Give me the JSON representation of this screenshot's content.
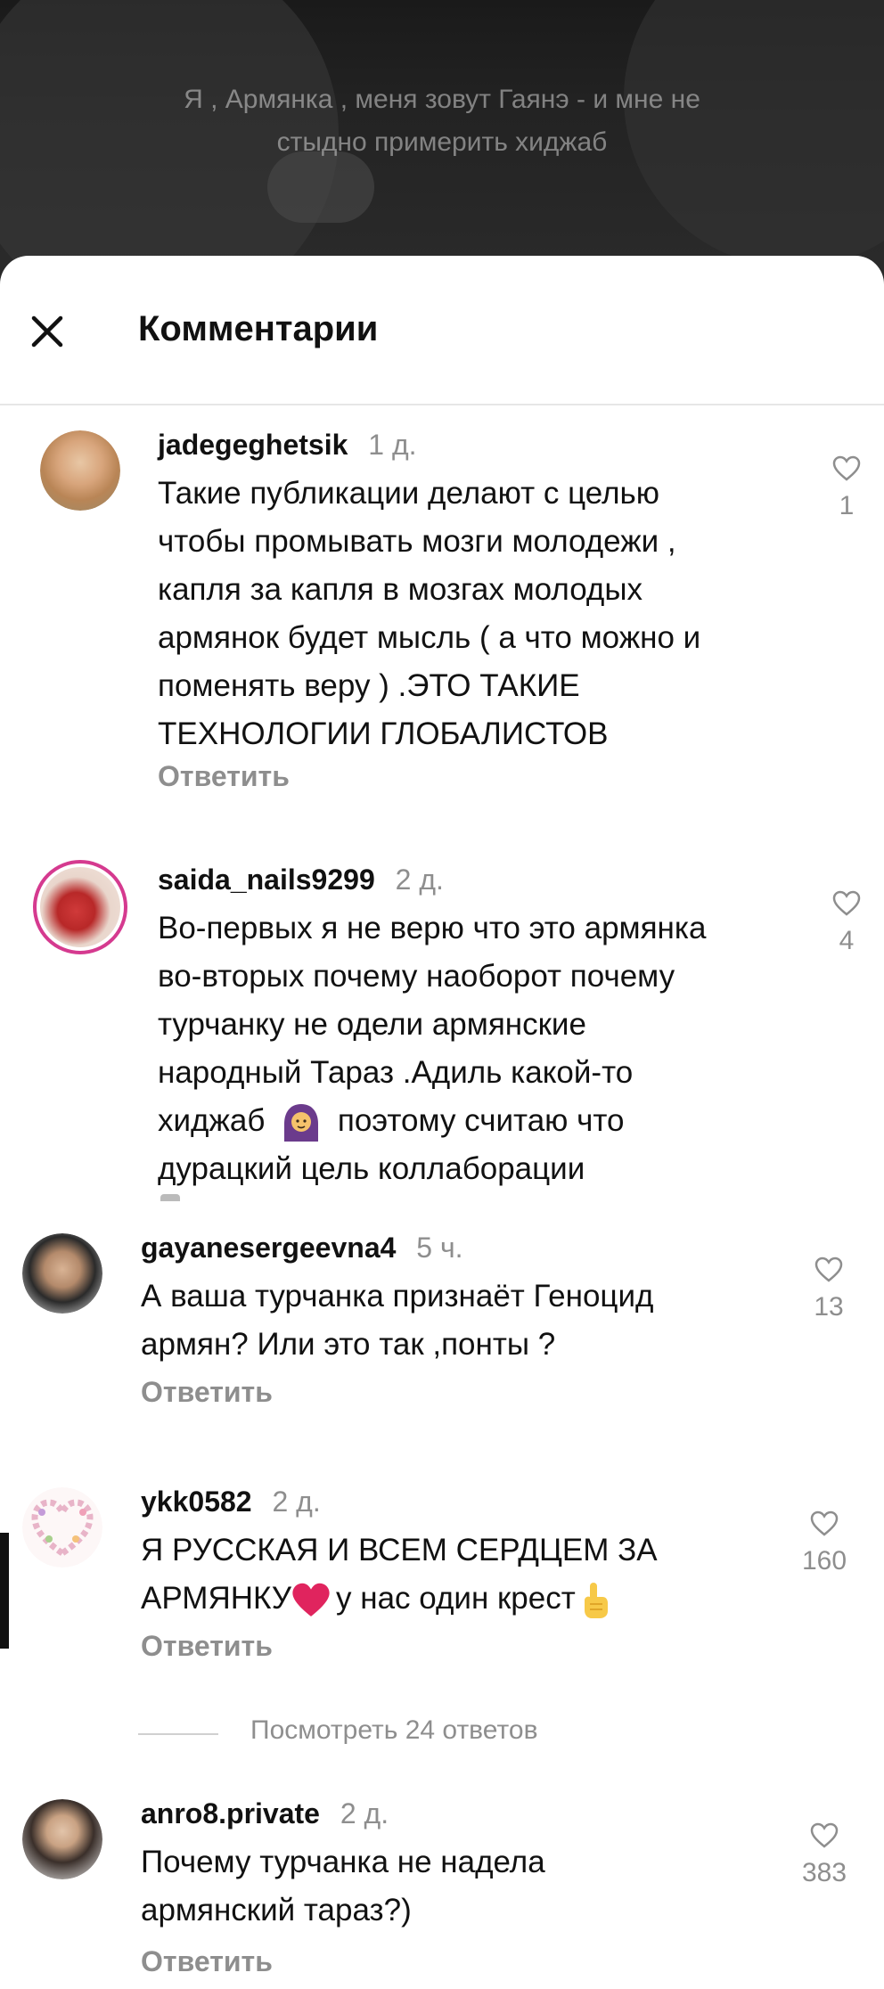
{
  "video": {
    "caption_line1": "Я , Армянка , меня зовут Гаянэ - и мне не",
    "caption_line2": "стыдно примерить хиджаб"
  },
  "sheet": {
    "title": "Комментарии",
    "close_icon": "close-icon"
  },
  "comments": [
    {
      "username": "jadegeghetsik",
      "time": "1 д.",
      "lines": [
        "Такие публикации делают с целью",
        "чтобы промывать мозги молодежи ,",
        "капля за капля в мозгах молодых",
        "армянок будет мысль ( а что можно и",
        "поменять веру ) .ЭТО ТАКИЕ",
        "ТЕХНОЛОГИИ ГЛОБАЛИСТОВ"
      ],
      "reply_label": "Ответить",
      "likes": "1"
    },
    {
      "username": "saida_nails9299",
      "time": "2 д.",
      "lines": [
        "Во-первых я не верю что это армянка",
        "во-вторых почему наоборот почему",
        "турчанку не одели армянские",
        "народный Тараз .Адиль какой-то"
      ],
      "line5_before": "хиджаб",
      "line5_after": "поэтому считаю что",
      "line6": "дурацкий цель коллаборации",
      "emoji": "woman-with-headscarf-emoji",
      "likes": "4"
    },
    {
      "username": "gayanesergeevna4",
      "time": "5 ч.",
      "lines": [
        "А ваша турчанка признаёт Геноцид",
        "армян? Или это так ,понты ?"
      ],
      "reply_label": "Ответить",
      "likes": "13"
    },
    {
      "username": "ykk0582",
      "time": "2 д.",
      "line1": "Я РУССКАЯ И ВСЕМ СЕРДЦЕМ ЗА",
      "line2_before": "АРМЯНКУ",
      "line2_after": "у нас один крест",
      "emoji1": "red-heart-emoji",
      "emoji2": "pointing-up-emoji",
      "reply_label": "Ответить",
      "likes": "160",
      "view_replies": "Посмотреть 24 ответов"
    },
    {
      "username": "anro8.private",
      "time": "2 д.",
      "lines": [
        "Почему турчанка не надела",
        "армянский тараз?)"
      ],
      "reply_label": "Ответить",
      "likes": "383"
    }
  ]
}
